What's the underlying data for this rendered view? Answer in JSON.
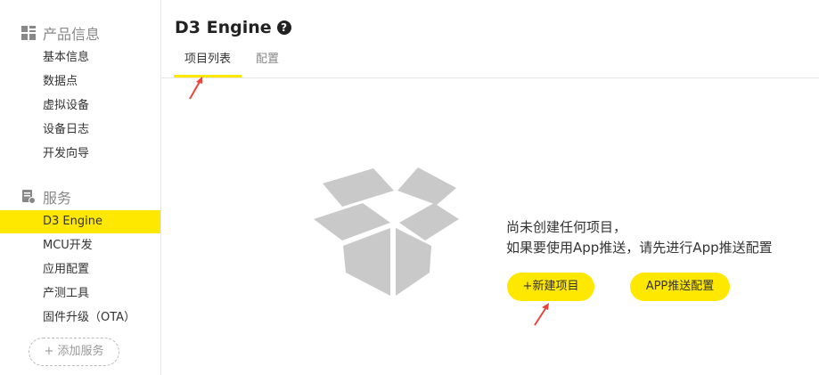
{
  "sidebar": {
    "sections": [
      {
        "title": "产品信息",
        "icon": "grid-icon"
      },
      {
        "title": "服务",
        "icon": "service-icon"
      }
    ],
    "product_items": [
      "基本信息",
      "数据点",
      "虚拟设备",
      "设备日志",
      "开发向导"
    ],
    "service_items": [
      "D3 Engine",
      "MCU开发",
      "应用配置",
      "产测工具",
      "固件升级（OTA）"
    ],
    "active_item": "D3 Engine",
    "add_service": "+ 添加服务"
  },
  "header": {
    "title": "D3 Engine",
    "help_icon": "question-circle-icon"
  },
  "tabs": [
    {
      "label": "项目列表",
      "active": true
    },
    {
      "label": "配置",
      "active": false
    }
  ],
  "empty_state": {
    "icon": "empty-box-icon",
    "line1": "尚未创建任何项目，",
    "line2": "如果要使用App推送，请先进行App推送配置",
    "new_project_button": "+新建项目",
    "app_push_button": "APP推送配置"
  },
  "colors": {
    "accent": "#ffe800",
    "annotation_arrow": "#e8453c",
    "box_gray": "#c9c9c9"
  }
}
